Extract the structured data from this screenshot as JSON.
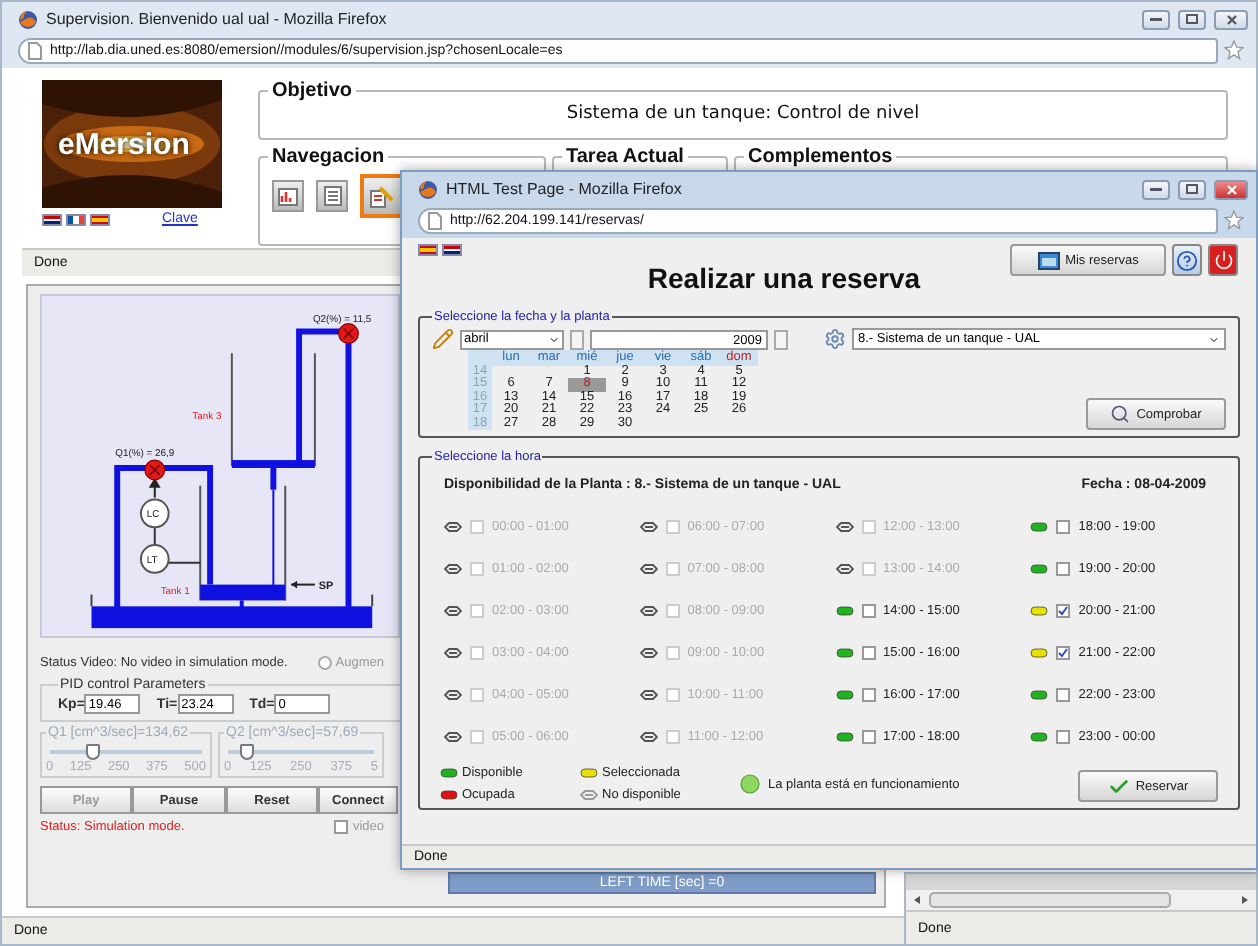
{
  "back_window": {
    "title": "Supervision. Bienvenido ual ual - Mozilla Firefox",
    "url": "http://lab.dia.uned.es:8080/emersion//modules/6/supervision.jsp?chosenLocale=es",
    "logo": "eMersion",
    "link": "Clave",
    "objective": {
      "legend": "Objetivo",
      "text": "Sistema de un tanque: Control de nivel"
    },
    "panels": [
      {
        "legend": "Navegacion"
      },
      {
        "legend": "Tarea Actual"
      },
      {
        "legend": "Complementos"
      }
    ],
    "nav_buttons": [
      {
        "selected": false
      },
      {
        "selected": false
      },
      {
        "selected": true
      }
    ],
    "status": "Done",
    "applet": {
      "diagram": {
        "q2": "Q2(%) = 11,5",
        "q1": "Q1(%) = 26,9",
        "tank_3": "Tank 3",
        "tank_1": "Tank 1",
        "lc": "LC",
        "lt": "LT",
        "sp": "SP"
      },
      "video_status": "Status Video: No video in simulation mode.",
      "augment": {
        "label": "Augmen",
        "checked": false
      },
      "pid": {
        "legend": "PID control Parameters",
        "fields": [
          {
            "label": "Kp=",
            "value": "19.46"
          },
          {
            "label": "Ti=",
            "value": "23.24"
          },
          {
            "label": "Td=",
            "value": "0"
          }
        ]
      },
      "sliders": [
        {
          "label": "Q1 [cm^3/sec]=134,62",
          "level": 0.27,
          "ticks": [
            "0",
            "125",
            "250",
            "375",
            "500"
          ]
        },
        {
          "label": "Q2 [cm^3/sec]=57,69",
          "level": 0.12,
          "ticks": [
            "0",
            "125",
            "250",
            "375",
            "5"
          ]
        }
      ],
      "buttons": [
        {
          "label": "Play",
          "disabled": true
        },
        {
          "label": "Pause",
          "disabled": false
        },
        {
          "label": "Reset",
          "disabled": false
        },
        {
          "label": "Connect",
          "disabled": false
        }
      ],
      "sim_status": "Status: Simulation mode.",
      "video": {
        "label": "video",
        "checked": false
      },
      "left_time": "LEFT TIME [sec] =0"
    },
    "bottom_status": "Done"
  },
  "front_window": {
    "title": "HTML Test Page - Mozilla Firefox",
    "url": "http://62.204.199.141/reservas/",
    "heading": "Realizar una reserva",
    "my_bookings": "Mis reservas",
    "date_section": {
      "legend": "Seleccione la fecha y la planta",
      "month": "abril",
      "year": "2009",
      "weekdays": [
        "lun",
        "mar",
        "mié",
        "jue",
        "vie",
        "sáb",
        "dom"
      ],
      "weeks": [
        {
          "number": "14",
          "days": [
            {
              "day": "1",
              "selected": false
            },
            {
              "day": "2",
              "selected": false
            },
            {
              "day": "3",
              "selected": false
            },
            {
              "day": "4",
              "selected": false
            },
            {
              "day": "5",
              "selected": false
            }
          ]
        },
        {
          "number": "15",
          "days": [
            {
              "day": "6",
              "selected": false
            },
            {
              "day": "7",
              "selected": false
            },
            {
              "day": "8",
              "selected": true
            },
            {
              "day": "9",
              "selected": false
            },
            {
              "day": "10",
              "selected": false
            },
            {
              "day": "11",
              "selected": false
            },
            {
              "day": "12",
              "selected": false
            }
          ]
        },
        {
          "number": "16",
          "days": [
            {
              "day": "13",
              "selected": false
            },
            {
              "day": "14",
              "selected": false
            },
            {
              "day": "15",
              "selected": false
            },
            {
              "day": "16",
              "selected": false
            },
            {
              "day": "17",
              "selected": false
            },
            {
              "day": "18",
              "selected": false
            },
            {
              "day": "19",
              "selected": false
            }
          ]
        },
        {
          "number": "17",
          "days": [
            {
              "day": "20",
              "selected": false
            },
            {
              "day": "21",
              "selected": false
            },
            {
              "day": "22",
              "selected": false
            },
            {
              "day": "23",
              "selected": false
            },
            {
              "day": "24",
              "selected": false
            },
            {
              "day": "25",
              "selected": false
            },
            {
              "day": "26",
              "selected": false
            }
          ]
        },
        {
          "number": "18",
          "days": [
            {
              "day": "27",
              "selected": false
            },
            {
              "day": "28",
              "selected": false
            },
            {
              "day": "29",
              "selected": false
            },
            {
              "day": "30",
              "selected": false
            }
          ]
        }
      ],
      "plant": "8.- Sistema de un tanque - UAL",
      "check_button": "Comprobar"
    },
    "hour_section": {
      "legend": "Seleccione la hora",
      "availability": "Disponibilidad de la Planta : 8.- Sistema de un tanque - UAL",
      "date": "Fecha : 08-04-2009",
      "slots": [
        {
          "time": "00:00 - 01:00",
          "kind": "unavailable",
          "checked": false
        },
        {
          "time": "01:00 - 02:00",
          "kind": "unavailable",
          "checked": false
        },
        {
          "time": "02:00 - 03:00",
          "kind": "unavailable",
          "checked": false
        },
        {
          "time": "03:00 - 04:00",
          "kind": "unavailable",
          "checked": false
        },
        {
          "time": "04:00 - 05:00",
          "kind": "unavailable",
          "checked": false
        },
        {
          "time": "05:00 - 06:00",
          "kind": "unavailable",
          "checked": false
        },
        {
          "time": "06:00 - 07:00",
          "kind": "unavailable",
          "checked": false
        },
        {
          "time": "07:00 - 08:00",
          "kind": "unavailable",
          "checked": false
        },
        {
          "time": "08:00 - 09:00",
          "kind": "unavailable",
          "checked": false
        },
        {
          "time": "09:00 - 10:00",
          "kind": "unavailable",
          "checked": false
        },
        {
          "time": "10:00 - 11:00",
          "kind": "unavailable",
          "checked": false
        },
        {
          "time": "11:00 - 12:00",
          "kind": "unavailable",
          "checked": false
        },
        {
          "time": "12:00 - 13:00",
          "kind": "unavailable",
          "checked": false
        },
        {
          "time": "13:00 - 14:00",
          "kind": "unavailable",
          "checked": false
        },
        {
          "time": "14:00 - 15:00",
          "kind": "available",
          "checked": false
        },
        {
          "time": "15:00 - 16:00",
          "kind": "available",
          "checked": false
        },
        {
          "time": "16:00 - 17:00",
          "kind": "available",
          "checked": false
        },
        {
          "time": "17:00 - 18:00",
          "kind": "available",
          "checked": false
        },
        {
          "time": "18:00 - 19:00",
          "kind": "available",
          "checked": false
        },
        {
          "time": "19:00 - 20:00",
          "kind": "available",
          "checked": false
        },
        {
          "time": "20:00 - 21:00",
          "kind": "selected",
          "checked": true
        },
        {
          "time": "21:00 - 22:00",
          "kind": "selected",
          "checked": true
        },
        {
          "time": "22:00 - 23:00",
          "kind": "available",
          "checked": false
        },
        {
          "time": "23:00 - 00:00",
          "kind": "available",
          "checked": false
        }
      ],
      "legend_items": [
        {
          "label": "Disponible",
          "color": "#1fb41f"
        },
        {
          "label": "Seleccionada",
          "color": "#e8e000"
        },
        {
          "label": "Ocupada",
          "color": "#e01010"
        },
        {
          "label": "No disponible",
          "color": "#9a9a9a"
        }
      ],
      "running": "La planta está en funcionamiento",
      "book_button": "Reservar"
    },
    "status": "Done"
  },
  "third_window": {
    "status": "Done"
  }
}
